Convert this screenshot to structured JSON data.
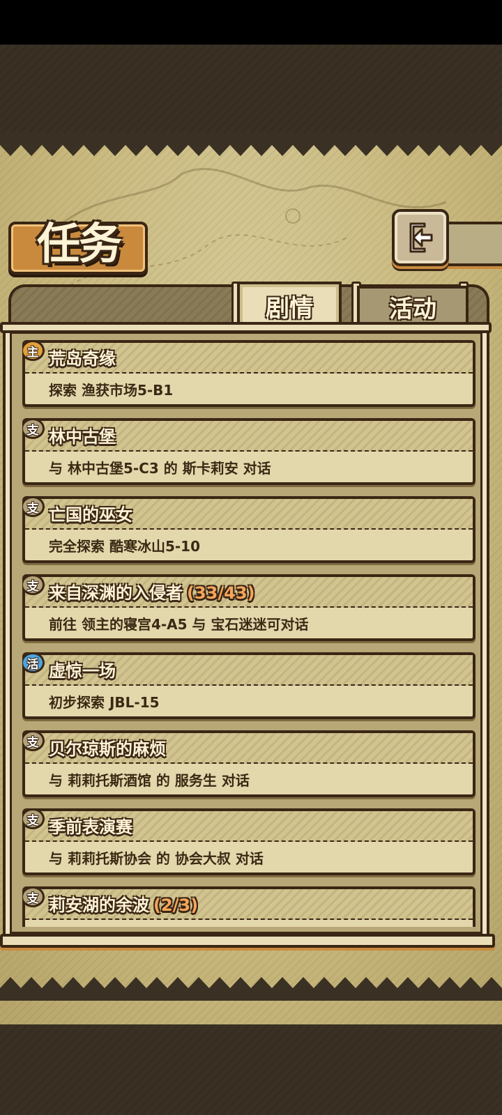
{
  "screen": {
    "title": "任务",
    "back_icon": "back-arrow-icon",
    "tabs": [
      {
        "label": "剧情",
        "active": true
      },
      {
        "label": "活动",
        "active": false
      }
    ]
  },
  "colors": {
    "parchment": "#c7b77c",
    "outline": "#3a2614",
    "accent_orange": "#c98a3e",
    "progress_text": "#f5a55c",
    "badge_main": "#e3a13a",
    "badge_side": "#b4a27a",
    "badge_event": "#4aa6e6"
  },
  "quests": [
    {
      "badge": "主",
      "badge_type": "main",
      "title": "荒岛奇缘",
      "progress": "",
      "desc": "探索 渔获市场5-B1"
    },
    {
      "badge": "支",
      "badge_type": "side",
      "title": "林中古堡",
      "progress": "",
      "desc": "与 林中古堡5-C3 的 斯卡莉安 对话"
    },
    {
      "badge": "支",
      "badge_type": "side",
      "title": "亡国的巫女",
      "progress": "",
      "desc": "完全探索 酷寒冰山5-10"
    },
    {
      "badge": "支",
      "badge_type": "side",
      "title": "来自深渊的入侵者",
      "progress": "(33/43)",
      "desc": "前往 领主的寝宫4-A5 与 宝石迷迷可对话"
    },
    {
      "badge": "活",
      "badge_type": "event",
      "title": "虚惊一场",
      "progress": "",
      "desc": "初步探索 JBL-15"
    },
    {
      "badge": "支",
      "badge_type": "side",
      "title": "贝尔琼斯的麻烦",
      "progress": "",
      "desc": "与 莉莉托斯酒馆 的 服务生 对话"
    },
    {
      "badge": "支",
      "badge_type": "side",
      "title": "季前表演赛",
      "progress": "",
      "desc": "与 莉莉托斯协会 的 协会大叔 对话"
    },
    {
      "badge": "支",
      "badge_type": "side",
      "title": "莉安湖的余波",
      "progress": "(2/3)",
      "desc": ""
    }
  ]
}
